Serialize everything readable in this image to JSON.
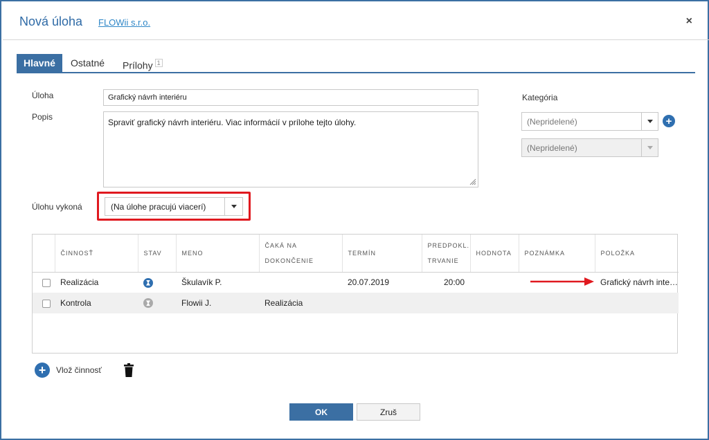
{
  "dialog": {
    "title": "Nová úloha",
    "company": "FLOWii s.r.o.",
    "close": "×"
  },
  "tabs": [
    {
      "label": "Hlavné",
      "active": true
    },
    {
      "label": "Ostatné",
      "active": false
    },
    {
      "label": "Prílohy",
      "active": false,
      "badge": "1"
    }
  ],
  "form": {
    "task_label": "Úloha",
    "task_value": "Grafický návrh interiéru",
    "desc_label": "Popis",
    "desc_value": "Spraviť grafický návrh interiéru. Viac informácií v prílohe tejto úlohy.",
    "category_label": "Kategória",
    "category1": "(Nepridelené)",
    "category2": "(Nepridelené)",
    "assignee_label": "Úlohu vykoná",
    "assignee_value": "(Na úlohe pracujú viacerí)"
  },
  "grid": {
    "headers": {
      "activity": "ČINNOSŤ",
      "status": "STAV",
      "name": "MENO",
      "waits_line1": "ČAKÁ NA",
      "waits_line2": "DOKONČENIE",
      "term": "TERMÍN",
      "est_line1": "PREDPOKL.",
      "est_line2": "TRVANIE",
      "value": "HODNOTA",
      "note": "POZNÁMKA",
      "item": "POLOŽKA"
    },
    "rows": [
      {
        "activity": "Realizácia",
        "name": "Škulavík P.",
        "waits": "",
        "term": "20.07.2019",
        "duration": "20:00",
        "value": "",
        "note": "",
        "item": "Grafický návrh interiéru"
      },
      {
        "activity": "Kontrola",
        "name": "Flowii J.",
        "waits": "Realizácia",
        "term": "",
        "duration": "",
        "value": "",
        "note": "",
        "item": ""
      }
    ]
  },
  "actions": {
    "add_activity": "Vlož činnosť",
    "ok": "OK",
    "cancel": "Zruš"
  },
  "colors": {
    "accent": "#3b6fa3",
    "highlight": "#e0191f"
  }
}
